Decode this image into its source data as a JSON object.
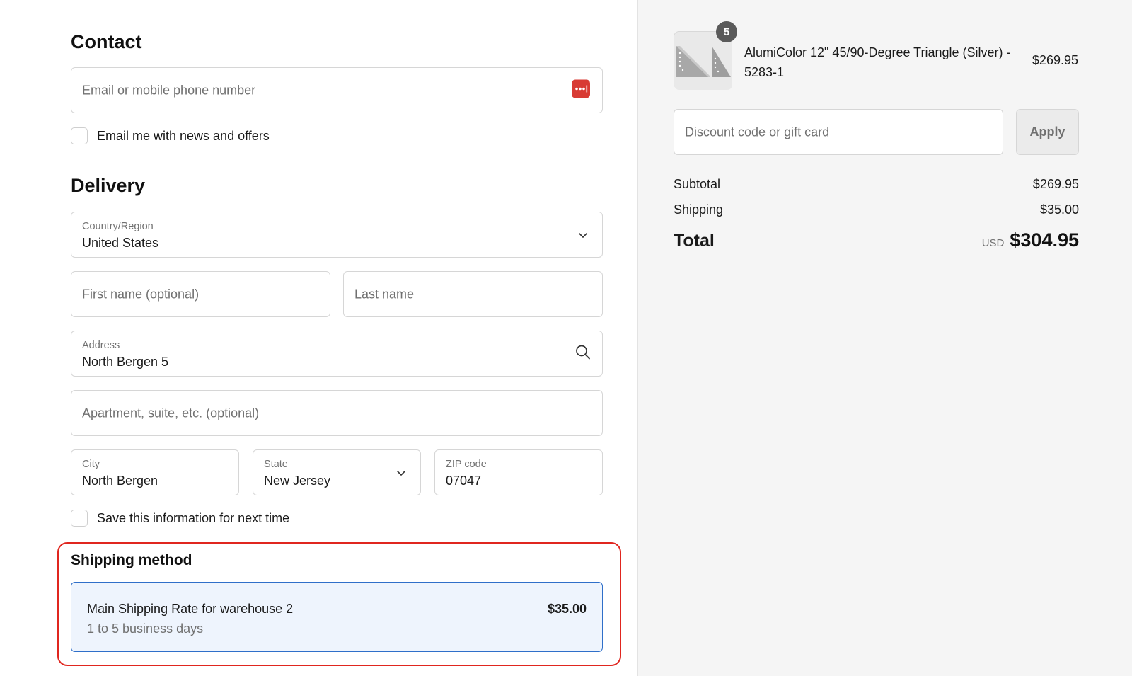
{
  "contact": {
    "title": "Contact",
    "email_placeholder": "Email or mobile phone number",
    "newsletter_label": "Email me with news and offers"
  },
  "delivery": {
    "title": "Delivery",
    "country": {
      "label": "Country/Region",
      "value": "United States"
    },
    "first_name_placeholder": "First name (optional)",
    "last_name_placeholder": "Last name",
    "address": {
      "label": "Address",
      "value": "North Bergen 5"
    },
    "apartment_placeholder": "Apartment, suite, etc. (optional)",
    "city": {
      "label": "City",
      "value": "North Bergen"
    },
    "state": {
      "label": "State",
      "value": "New Jersey"
    },
    "zip": {
      "label": "ZIP code",
      "value": "07047"
    },
    "save_label": "Save this information for next time"
  },
  "shipping_method": {
    "title": "Shipping method",
    "option": {
      "name": "Main Shipping Rate for warehouse 2",
      "days": "1 to 5 business days",
      "price": "$35.00"
    },
    "highlight_color": "#e0261f",
    "selected_color": "#2f6fc9"
  },
  "order_summary": {
    "item": {
      "quantity": "5",
      "name": "AlumiColor 12\" 45/90-Degree Triangle (Silver) - 5283-1",
      "price": "$269.95"
    },
    "discount_placeholder": "Discount code or gift card",
    "apply_label": "Apply",
    "subtotal_label": "Subtotal",
    "subtotal_value": "$269.95",
    "shipping_label": "Shipping",
    "shipping_value": "$35.00",
    "total_label": "Total",
    "currency": "USD",
    "total_value": "$304.95"
  },
  "icons": {
    "password_manager": "password-manager-icon",
    "search": "search-icon",
    "chevron": "chevron-down-icon"
  }
}
